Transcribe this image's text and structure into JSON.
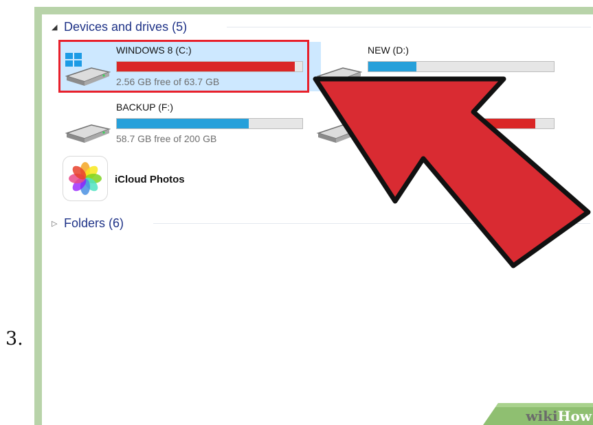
{
  "step_number": "3.",
  "explorer": {
    "groups": [
      {
        "label": "Devices and drives (5)",
        "expanded": true
      },
      {
        "label": "Folders (6)",
        "expanded": false
      }
    ],
    "drives": [
      {
        "name": "WINDOWS 8 (C:)",
        "free_text": "2.56 GB free of 63.7 GB",
        "used_fraction": 0.96,
        "bar_color": "#da2626",
        "selected": true
      },
      {
        "name": "NEW (D:)",
        "free_text": "",
        "used_fraction": 0.26,
        "bar_color": "#26a0da",
        "selected": false
      },
      {
        "name": "BACKUP (F:)",
        "free_text": "58.7 GB free of 200 GB",
        "used_fraction": 0.71,
        "bar_color": "#26a0da",
        "selected": false
      },
      {
        "name": "",
        "free_text": "",
        "used_fraction": 0.9,
        "bar_color": "#da2626",
        "selected": false
      }
    ],
    "app": {
      "name": "iCloud Photos",
      "icon": "icloud-photos-icon"
    }
  },
  "watermark": {
    "part1": "wiki",
    "part2": "How"
  },
  "colors": {
    "highlight_box": "#e8202b",
    "arrow": "#d92b32",
    "selected_bg": "#cde8ff",
    "frame": "#b8d3a9"
  }
}
